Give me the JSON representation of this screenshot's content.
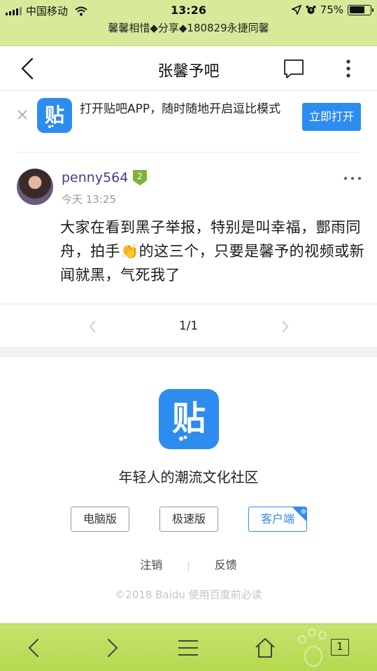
{
  "status_bar": {
    "carrier": "中国移动",
    "time": "13:26",
    "battery": "75%",
    "battery_level": 0.75
  },
  "browser": {
    "url_title": "馨馨相惜◆分享◆180829永捷同馨",
    "tab_count": "1"
  },
  "header": {
    "title": "张馨予吧"
  },
  "app_banner": {
    "logo_char": "贴",
    "text": "打开贴吧APP，随时随地开启逗比模式",
    "open_button": "立即打开"
  },
  "post": {
    "username": "penny564",
    "level": "2",
    "time": "今天 13:25",
    "content": "大家在看到黑子举报，特别是叫幸福，酆雨同舟，拍手👏的这三个，只要是馨予的视频或新闻就黑，气死我了"
  },
  "pager": {
    "text": "1/1"
  },
  "footer": {
    "logo_char": "贴",
    "slogan": "年轻人的潮流文化社区",
    "buttons": {
      "pc": "电脑版",
      "lite": "极速版",
      "client": "客户端",
      "client_badge": "荐"
    },
    "links": {
      "logout": "注销",
      "feedback": "反馈"
    },
    "copyright": "©2018 Baidu 使用百度前必读"
  },
  "icons": {
    "wifi": "wifi-icon",
    "location": "location-arrow-icon",
    "alarm": "alarm-icon",
    "back": "chevron-left-icon",
    "comment": "comment-icon",
    "more": "more-vertical-icon"
  },
  "colors": {
    "accent_blue": "#2d8cf0",
    "browser_green": "#b5d94f",
    "username_purple": "#4a3a8c",
    "badge_green": "#7fb23a"
  }
}
